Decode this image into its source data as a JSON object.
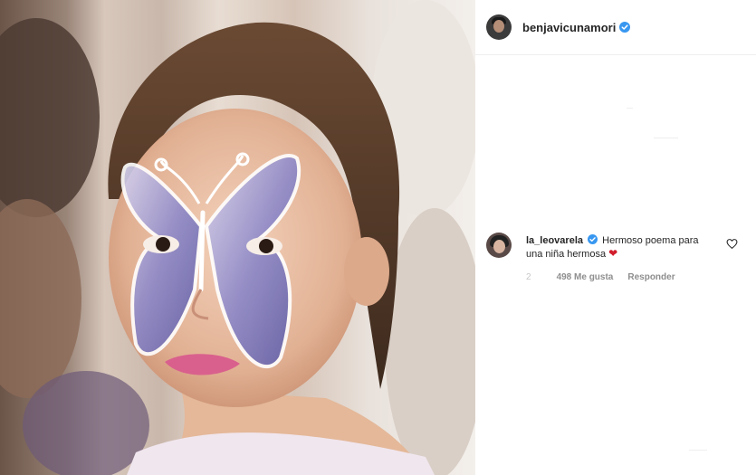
{
  "post": {
    "author": {
      "username": "benjavicunamori",
      "verified": true
    },
    "photo": {
      "subject": "girl with butterfly face paint"
    }
  },
  "comments": [
    {
      "username": "la_leovarela",
      "verified": true,
      "text": "Hermoso poema para una niña hermosa",
      "emoji": "❤",
      "time": "2",
      "likes": "498 Me gusta",
      "reply_label": "Responder"
    }
  ],
  "colors": {
    "verified_blue": "#3897f0",
    "username_text": "#262626",
    "meta_text": "#8e8e8e",
    "heart_red": "#d11d2c"
  },
  "icons": [
    "verified-badge-icon",
    "heart-outline-icon"
  ]
}
